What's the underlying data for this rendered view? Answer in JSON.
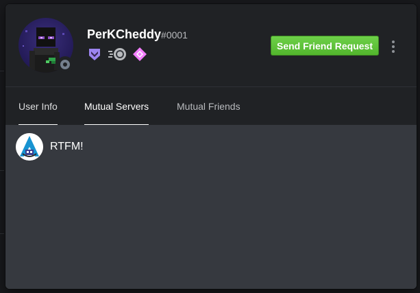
{
  "profile": {
    "username": "PerKCheddy",
    "discriminator": "#0001",
    "status": "offline",
    "badges": [
      "hypesquad-icon",
      "nitro-boost-icon",
      "nitro-gem-icon"
    ]
  },
  "actions": {
    "friend_request_label": "Send Friend Request"
  },
  "tabs": [
    {
      "label": "User Info"
    },
    {
      "label": "Mutual Servers"
    },
    {
      "label": "Mutual Friends"
    }
  ],
  "mutual_servers": [
    {
      "name": "RTFM!"
    }
  ],
  "colors": {
    "accent_green": "#43b581",
    "header_bg": "#202225",
    "body_bg": "#36393f",
    "hypesquad": "#9c84ef",
    "gem": "#f47fff"
  }
}
